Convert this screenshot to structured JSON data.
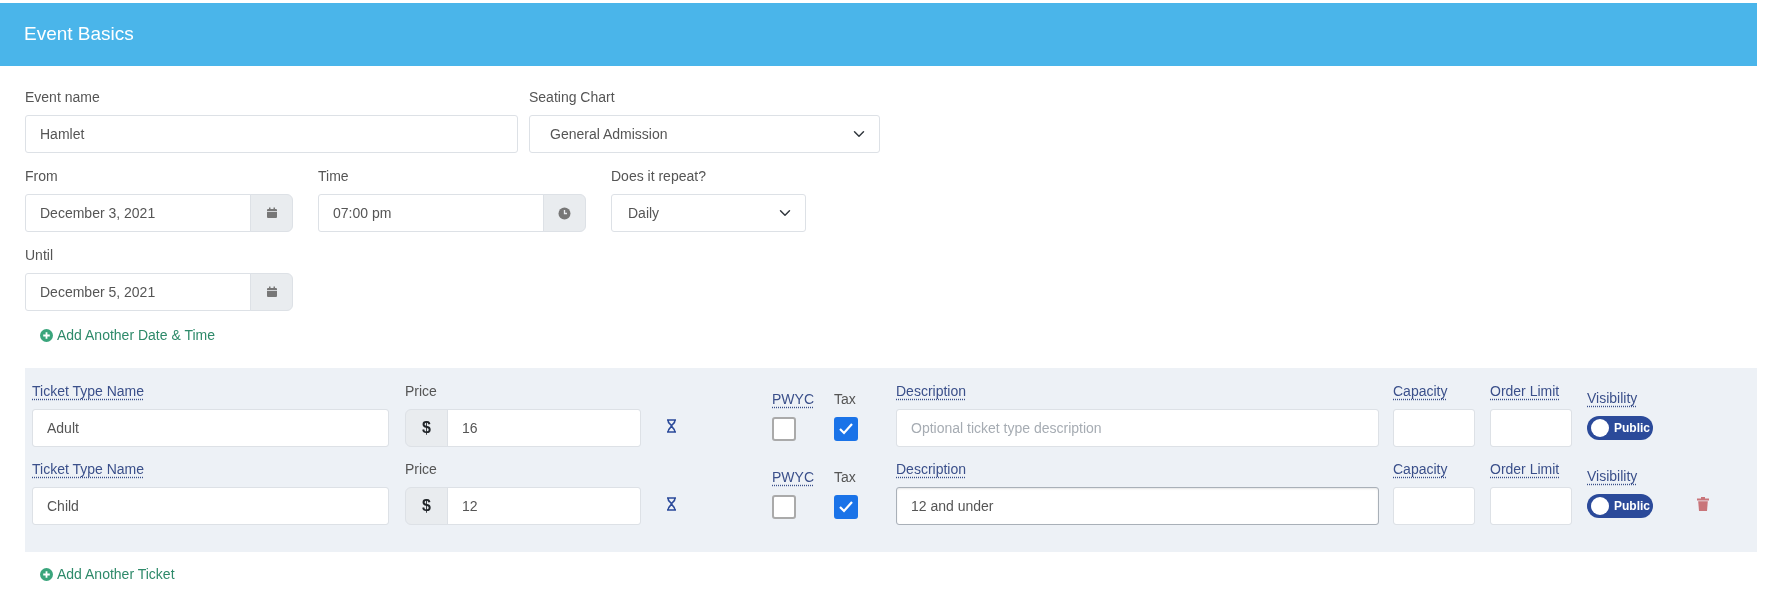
{
  "header": {
    "title": "Event Basics"
  },
  "event_name": {
    "label": "Event name",
    "value": "Hamlet"
  },
  "seating_chart": {
    "label": "Seating Chart",
    "value": "General Admission"
  },
  "from": {
    "label": "From",
    "value": "December 3, 2021"
  },
  "time": {
    "label": "Time",
    "value": "07:00 pm"
  },
  "repeat": {
    "label": "Does it repeat?",
    "value": "Daily"
  },
  "until": {
    "label": "Until",
    "value": "December 5, 2021"
  },
  "add_date_link": "Add Another Date & Time",
  "tickets": [
    {
      "name_label": "Ticket Type Name",
      "name": "Adult",
      "price_label": "Price",
      "currency": "$",
      "price": "16",
      "pwyc_label": "PWYC",
      "pwyc": false,
      "tax_label": "Tax",
      "tax": true,
      "description_label": "Description",
      "description_placeholder": "Optional ticket type description",
      "description_focused": false,
      "capacity_label": "Capacity",
      "order_limit_label": "Order Limit",
      "visibility_label": "Visibility",
      "visibility": "Public",
      "deletable": false
    },
    {
      "name_label": "Ticket Type Name",
      "name": "Child",
      "price_label": "Price",
      "currency": "$",
      "price": "12",
      "pwyc_label": "PWYC",
      "pwyc": false,
      "tax_label": "Tax",
      "tax": true,
      "description_label": "Description",
      "description": "12 and under",
      "description_focused": true,
      "capacity_label": "Capacity",
      "order_limit_label": "Order Limit",
      "visibility_label": "Visibility",
      "visibility": "Public",
      "deletable": true
    }
  ],
  "add_ticket_link": "Add Another Ticket"
}
